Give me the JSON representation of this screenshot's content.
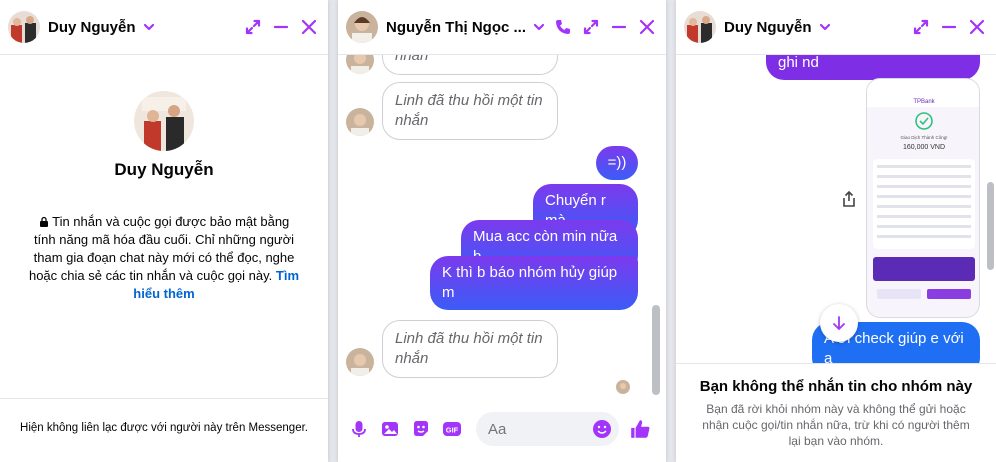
{
  "colors": {
    "accent": "#a334fa",
    "bubble_out_top": "#7c3aed",
    "bubble_out_bottom": "#3b5cf6",
    "link": "#0064d1"
  },
  "win1": {
    "header_name": "Duy Nguyễn",
    "profile_name": "Duy Nguyễn",
    "encryption_text": "Tin nhắn và cuộc gọi được bảo mật bằng tính năng mã hóa đầu cuối. Chỉ những người tham gia đoạn chat này mới có thể đọc, nghe hoặc chia sẻ các tin nhắn và cuộc gọi này.",
    "learn_more": "Tìm hiểu thêm",
    "footer": "Hiện không liên lạc được với người này trên Messenger."
  },
  "win2": {
    "header_name": "Nguyễn Thị Ngọc ...",
    "top_partial": "nhắn",
    "messages": [
      {
        "text": "Linh đã thu hồi một tin nhắn"
      },
      {
        "text": "=))"
      },
      {
        "text": "Chuyển r mà"
      },
      {
        "text": "Mua acc còn min nữa b"
      },
      {
        "text": "K thì b báo nhóm hủy giúp m"
      },
      {
        "text": "Linh đã thu hồi một tin nhắn"
      }
    ],
    "composer_placeholder": "Aa",
    "icons": [
      "microphone-icon",
      "image-icon",
      "sticker-icon",
      "gif-icon",
      "emoji-icon",
      "like-icon"
    ],
    "gif_label": "GIF"
  },
  "win3": {
    "header_name": "Duy Nguyễn",
    "top_message": "ghi nd",
    "bank_brand": "TPBank",
    "bank_status": "Giao Dịch Thành Công!",
    "bank_amount": "160,000 VND",
    "bottom_message": "A ơi check giúp e với ạ",
    "footer_title": "Bạn không thể nhắn tin cho nhóm này",
    "footer_desc": "Bạn đã rời khỏi nhóm này và không thể gửi hoặc nhận cuộc gọi/tin nhắn nữa, trừ khi có người thêm lại bạn vào nhóm."
  }
}
